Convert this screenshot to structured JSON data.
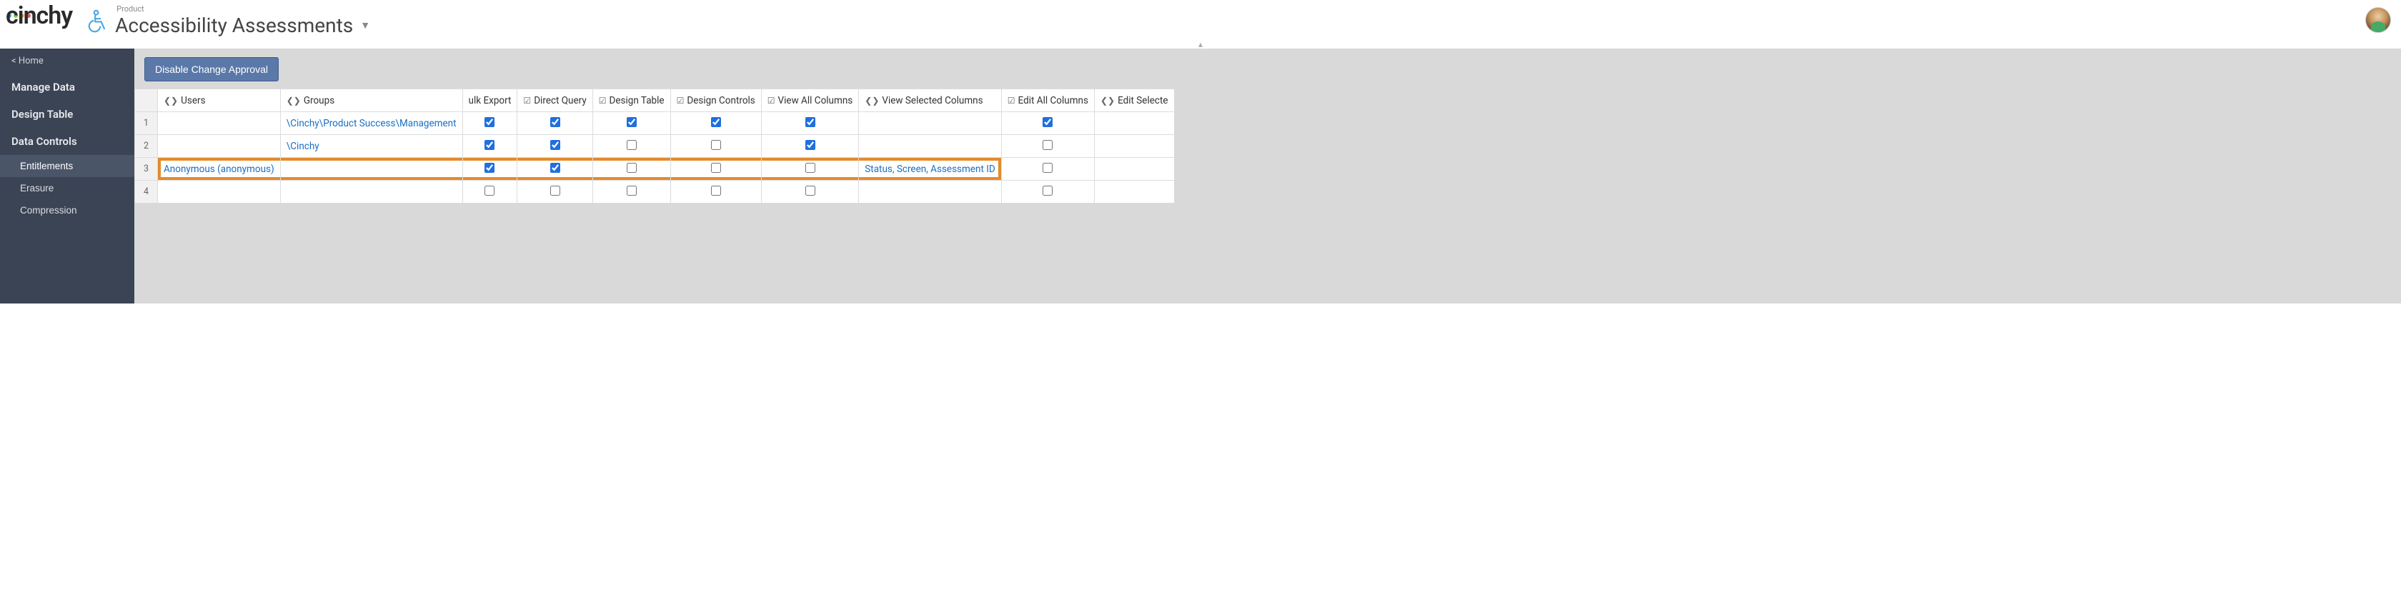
{
  "brand": {
    "name": "cinchy",
    "dot_colors": [
      "#3aa3e3",
      "#8fc74a",
      "#f5b63e",
      "#e25b5b"
    ]
  },
  "product": {
    "breadcrumb": "Product",
    "title": "Accessibility Assessments",
    "icon_accent": "#4aa6e0"
  },
  "sidebar": {
    "home": "< Home",
    "sections": [
      {
        "label": "Manage Data"
      },
      {
        "label": "Design Table"
      },
      {
        "label": "Data Controls",
        "children": [
          {
            "label": "Entitlements",
            "active": true
          },
          {
            "label": "Erasure"
          },
          {
            "label": "Compression"
          }
        ]
      }
    ]
  },
  "toolbar": {
    "disable_change_approval": "Disable Change Approval"
  },
  "table": {
    "columns": [
      {
        "key": "row",
        "label": ""
      },
      {
        "key": "users",
        "label": "Users",
        "icon": "share"
      },
      {
        "key": "groups",
        "label": "Groups",
        "icon": "share"
      },
      {
        "key": "bulk_export",
        "label": "ulk Export",
        "icon": "check"
      },
      {
        "key": "direct_query",
        "label": "Direct Query",
        "icon": "check"
      },
      {
        "key": "design_table",
        "label": "Design Table",
        "icon": "check"
      },
      {
        "key": "design_controls",
        "label": "Design Controls",
        "icon": "check"
      },
      {
        "key": "view_all_columns",
        "label": "View All Columns",
        "icon": "check"
      },
      {
        "key": "view_selected_columns",
        "label": "View Selected Columns",
        "icon": "share"
      },
      {
        "key": "edit_all_columns",
        "label": "Edit All Columns",
        "icon": "check"
      },
      {
        "key": "edit_selected",
        "label": "Edit Selecte",
        "icon": "share"
      }
    ],
    "rows": [
      {
        "n": "1",
        "users": "",
        "groups": "\\Cinchy\\Product Success\\Management",
        "bulk_export": true,
        "direct_query": true,
        "design_table": true,
        "design_controls": true,
        "view_all_columns": true,
        "view_selected_columns": "",
        "edit_all_columns": true
      },
      {
        "n": "2",
        "users": "",
        "groups": "\\Cinchy",
        "bulk_export": true,
        "direct_query": true,
        "design_table": false,
        "design_controls": false,
        "view_all_columns": true,
        "view_selected_columns": "",
        "edit_all_columns": false
      },
      {
        "n": "3",
        "users": "Anonymous (anonymous)",
        "groups": "",
        "bulk_export": true,
        "direct_query": true,
        "design_table": false,
        "design_controls": false,
        "view_all_columns": false,
        "view_selected_columns": "Status, Screen, Assessment ID",
        "edit_all_columns": false,
        "highlight": true
      },
      {
        "n": "4",
        "users": "",
        "groups": "",
        "bulk_export": false,
        "direct_query": false,
        "design_table": false,
        "design_controls": false,
        "view_all_columns": false,
        "view_selected_columns": "",
        "edit_all_columns": false
      }
    ]
  }
}
